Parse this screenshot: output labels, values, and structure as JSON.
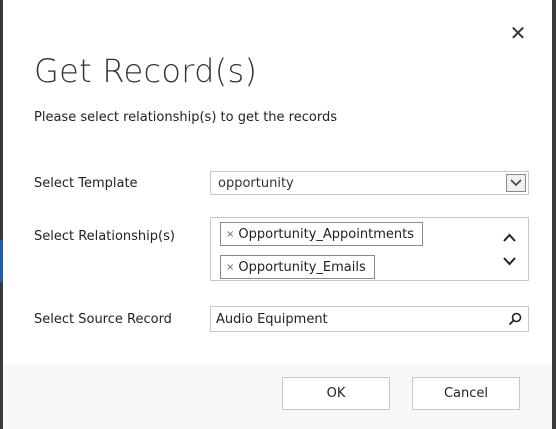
{
  "dialog": {
    "close_glyph": "✕",
    "title": "Get Record(s)",
    "subtitle": "Please select relationship(s) to get the records"
  },
  "form": {
    "template": {
      "label": "Select Template",
      "value": "opportunity"
    },
    "relationships": {
      "label": "Select Relationship(s)",
      "remove_glyph": "×",
      "items": [
        "Opportunity_Appointments",
        "Opportunity_Emails"
      ]
    },
    "source_record": {
      "label": "Select Source Record",
      "value": "Audio Equipment"
    }
  },
  "footer": {
    "ok_label": "OK",
    "cancel_label": "Cancel"
  },
  "colors": {
    "frame": "#3a3a3a",
    "footer_bg": "#f8f8f8",
    "border": "#c8c8c8",
    "accent": "#1e5fa8"
  },
  "icons": [
    "close-icon",
    "chevron-down-icon",
    "remove-icon",
    "chevron-up-icon",
    "search-icon"
  ]
}
